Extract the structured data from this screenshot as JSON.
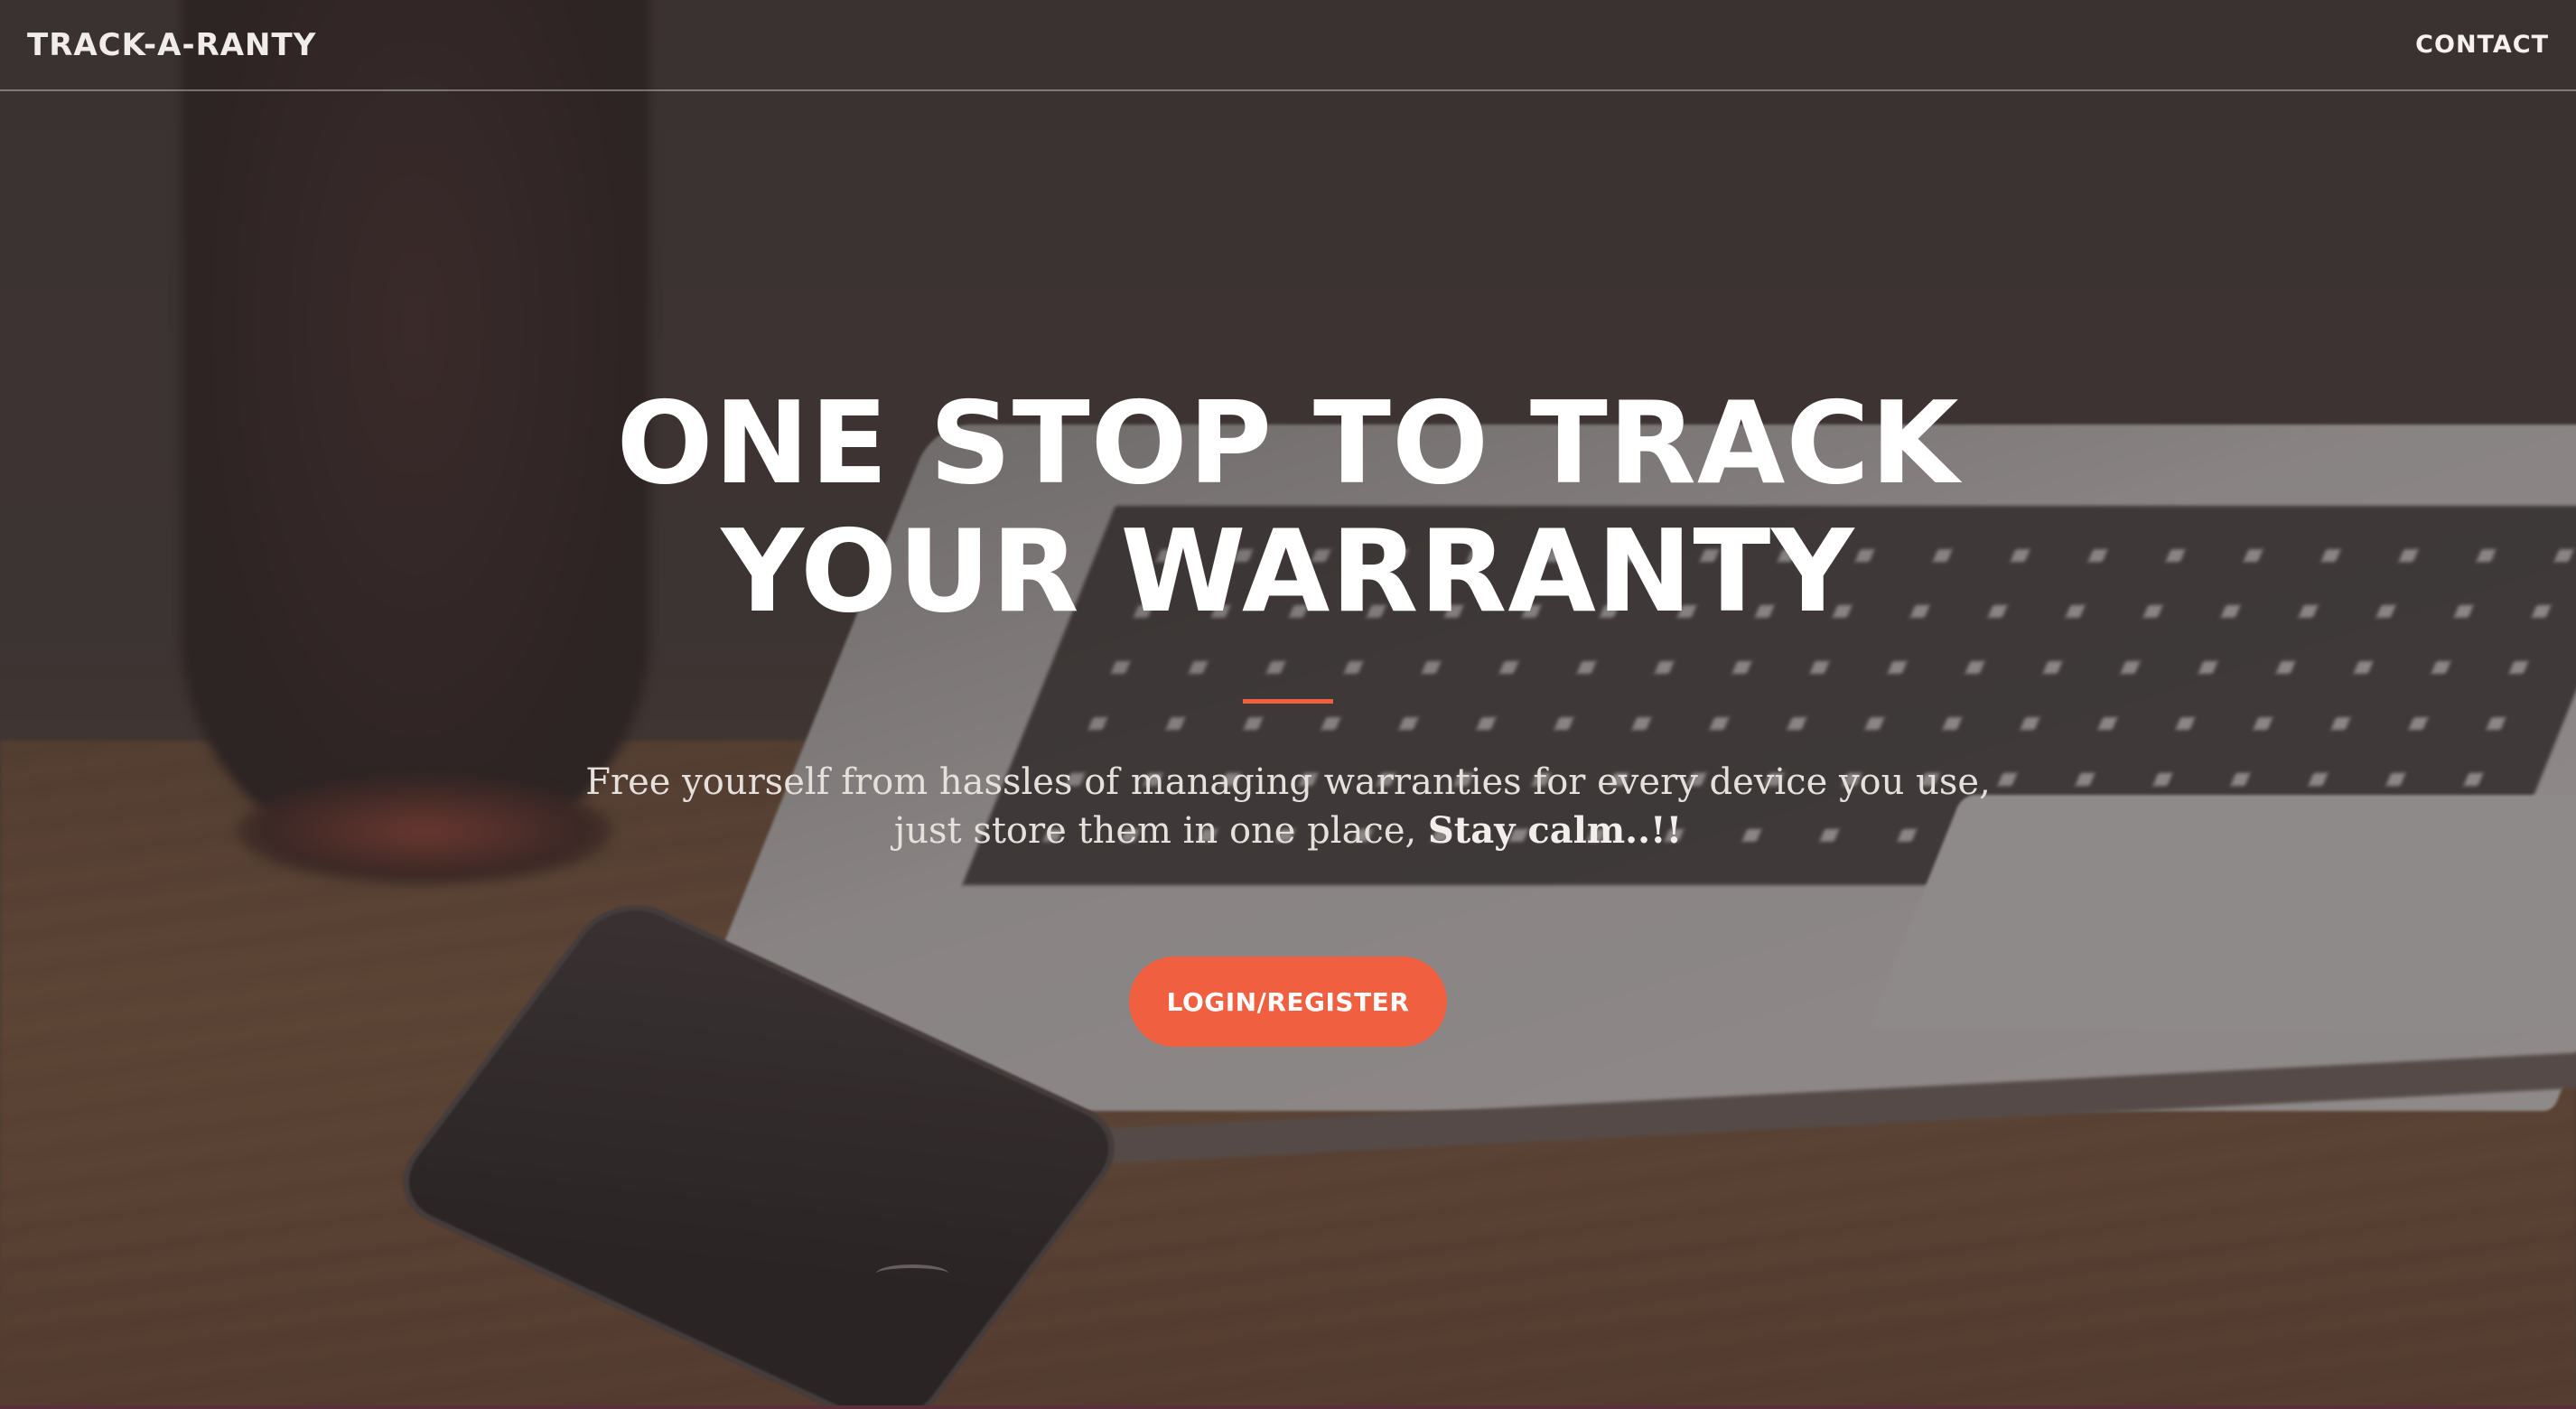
{
  "navbar": {
    "brand": "TRACK-A-RANTY",
    "contact_label": "CONTACT"
  },
  "hero": {
    "headline": "ONE STOP TO TRACK YOUR WARRANTY",
    "subtitle_text": "Free yourself from hassles of managing warranties for every device you use, just store them in one place, ",
    "subtitle_emphasis": "Stay calm..!!",
    "cta_label": "LOGIN/REGISTER"
  },
  "colors": {
    "accent": "#f05f40",
    "text": "#ffffff",
    "overlay": "#3c3232"
  }
}
